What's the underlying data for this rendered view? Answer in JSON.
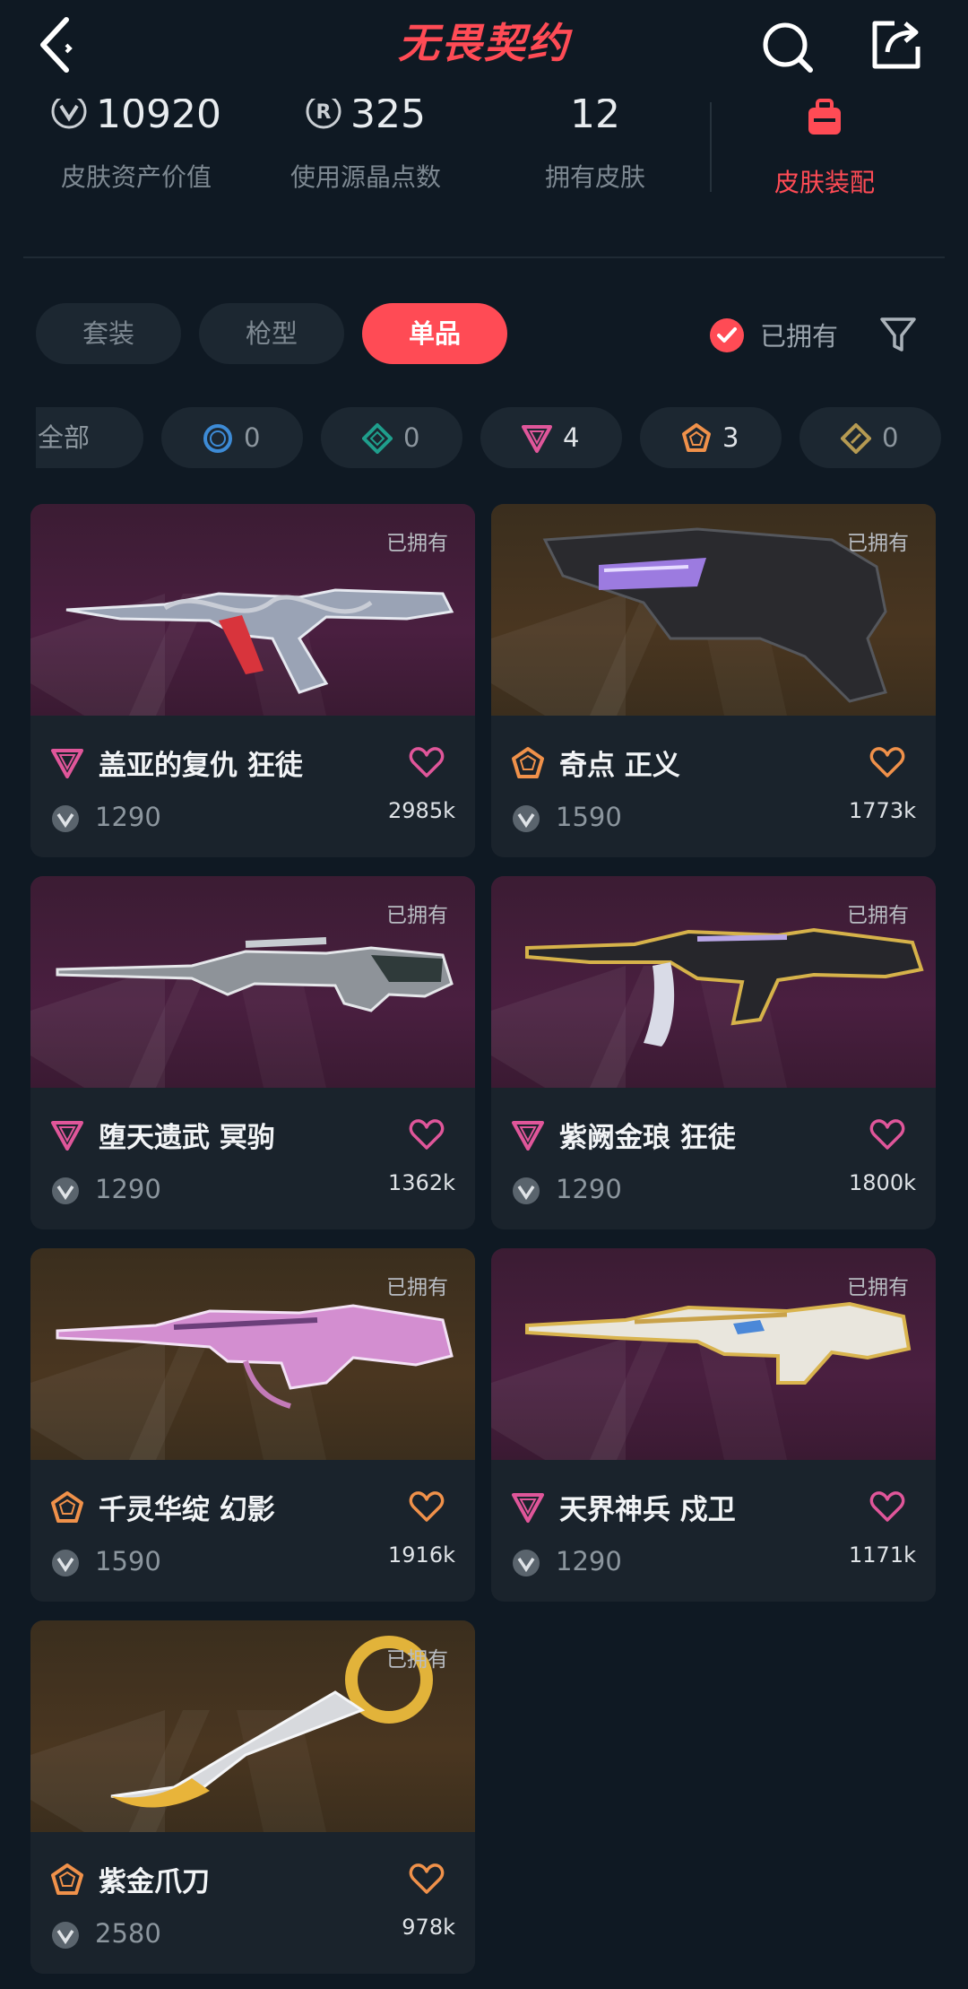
{
  "header": {
    "logo_text": "无畏契约"
  },
  "stats": [
    {
      "value": "10920",
      "label": "皮肤资产价值",
      "icon": "vp-icon"
    },
    {
      "value": "325",
      "label": "使用源晶点数",
      "icon": "radianite-icon"
    },
    {
      "value": "12",
      "label": "拥有皮肤"
    }
  ],
  "equip": {
    "label": "皮肤装配",
    "icon": "backpack-icon"
  },
  "tabs": [
    "套装",
    "枪型",
    "单品"
  ],
  "active_tab": "单品",
  "owned_filter": {
    "label": "已拥有",
    "checked": true
  },
  "rarity_filters": [
    {
      "label": "全部"
    },
    {
      "icon": "select-tier-icon",
      "count": "0",
      "color": "#3d8bd6"
    },
    {
      "icon": "deluxe-tier-icon",
      "count": "0",
      "color": "#1f9e8c"
    },
    {
      "icon": "premium-tier-icon",
      "count": "4",
      "color": "#e0569a"
    },
    {
      "icon": "exclusive-tier-icon",
      "count": "3",
      "color": "#f0914a"
    },
    {
      "icon": "ultra-tier-icon",
      "count": "0",
      "color": "#b59a52"
    }
  ],
  "skins": [
    {
      "name": "盖亚的复仇 狂徒",
      "price": "1290",
      "likes": "2985k",
      "owned_tag": "已拥有",
      "tier": "premium",
      "theme": "purple"
    },
    {
      "name": "奇点 正义",
      "price": "1590",
      "likes": "1773k",
      "owned_tag": "已拥有",
      "tier": "exclusive",
      "theme": "gold"
    },
    {
      "name": "堕天遗武 冥驹",
      "price": "1290",
      "likes": "1362k",
      "owned_tag": "已拥有",
      "tier": "premium",
      "theme": "purple"
    },
    {
      "name": "紫阙金琅 狂徒",
      "price": "1290",
      "likes": "1800k",
      "owned_tag": "已拥有",
      "tier": "premium",
      "theme": "purple"
    },
    {
      "name": "千灵华绽 幻影",
      "price": "1590",
      "likes": "1916k",
      "owned_tag": "已拥有",
      "tier": "exclusive",
      "theme": "gold"
    },
    {
      "name": "天界神兵 戍卫",
      "price": "1290",
      "likes": "1171k",
      "owned_tag": "已拥有",
      "tier": "premium",
      "theme": "purple"
    },
    {
      "name": "紫金爪刀",
      "price": "2580",
      "likes": "978k",
      "owned_tag": "已拥有",
      "tier": "exclusive",
      "theme": "gold"
    }
  ],
  "colors": {
    "accent": "#ff4b55",
    "premium": "#e0569a",
    "exclusive": "#f0914a"
  }
}
